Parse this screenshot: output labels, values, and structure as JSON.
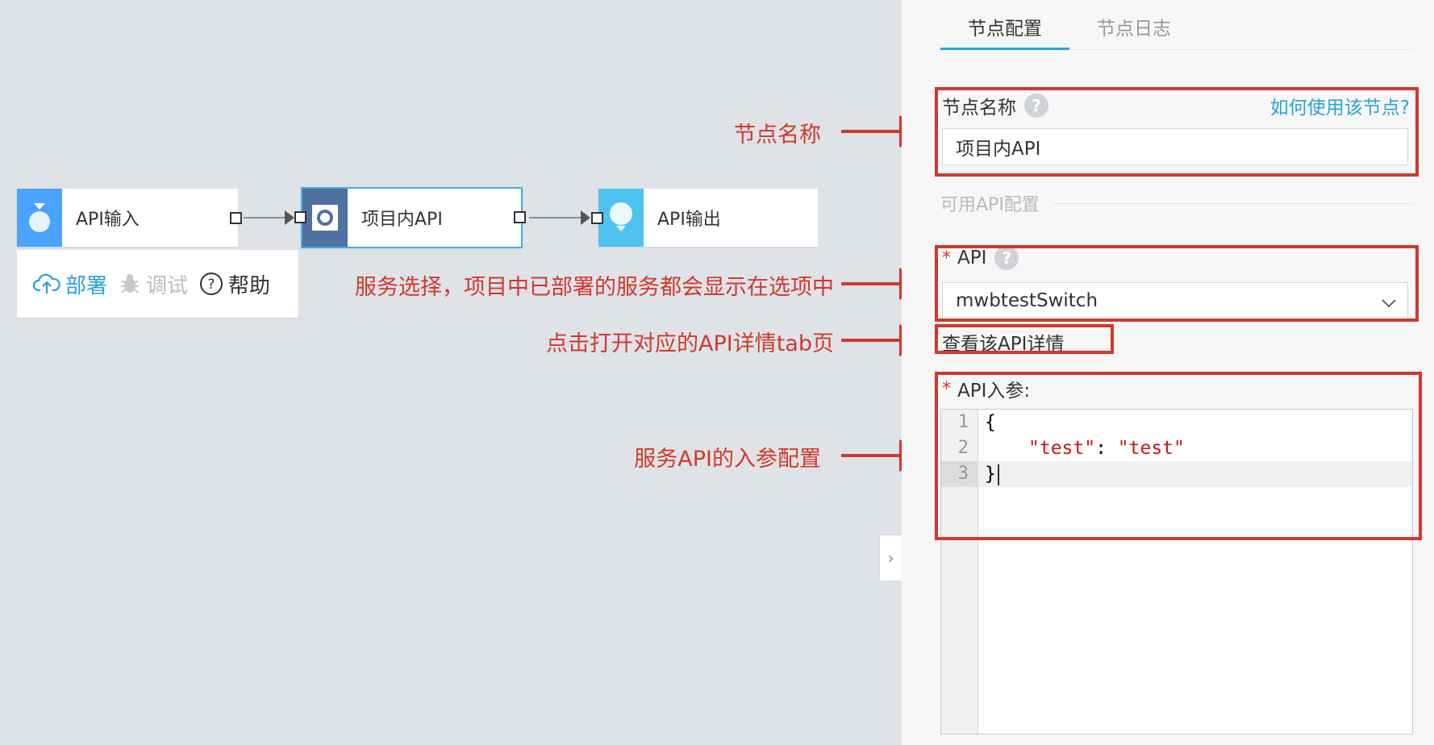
{
  "canvas": {
    "nodes": [
      {
        "label": "API输入",
        "icon": "api-input-icon",
        "color": "#4aa3ff"
      },
      {
        "label": "项目内API",
        "icon": "project-api-icon",
        "color": "#4f72a3"
      },
      {
        "label": "API输出",
        "icon": "api-output-icon",
        "color": "#4fc3f0"
      }
    ],
    "toolbar": {
      "deploy": "部署",
      "debug": "调试",
      "help": "帮助"
    }
  },
  "annotations": {
    "node_name": "节点名称",
    "service_select": "服务选择，项目中已部署的服务都会显示在选项中",
    "api_detail": "点击打开对应的API详情tab页",
    "input_params": "服务API的入参配置"
  },
  "panel": {
    "tabs": [
      "节点配置",
      "节点日志"
    ],
    "node_name_label": "节点名称",
    "how_to_use": "如何使用该节点?",
    "node_name_value": "项目内API",
    "section_title": "可用API配置",
    "api_label": "API",
    "api_value": "mwbtestSwitch",
    "detail_link": "查看该API详情",
    "params_label": "API入参:",
    "help_mark": "?",
    "editor": {
      "line_numbers": [
        "1",
        "2",
        "3"
      ],
      "lines": {
        "open": "{",
        "key": "\"test\"",
        "sep": ": ",
        "value": "\"test\"",
        "close": "}"
      }
    }
  },
  "colors": {
    "accent": "#2aa3d8",
    "annotation_red": "#d2382b",
    "canvas_bg": "#dfe3e8"
  }
}
